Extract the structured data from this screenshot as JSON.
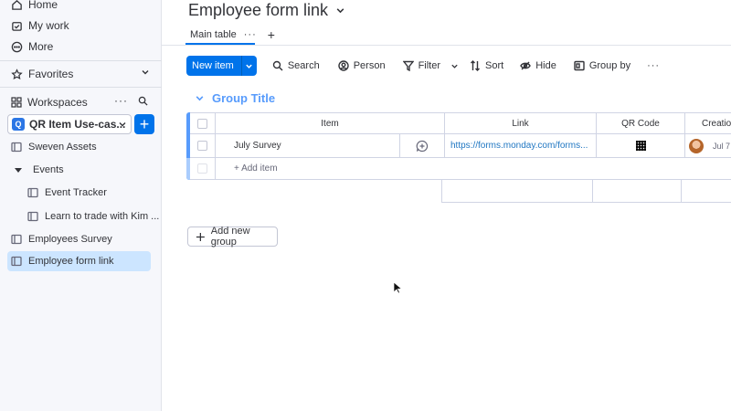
{
  "sidebar": {
    "nav": [
      {
        "label": "Home",
        "icon": "home-icon"
      },
      {
        "label": "My work",
        "icon": "calendar-check-icon"
      },
      {
        "label": "More",
        "icon": "more-circle-icon"
      }
    ],
    "favorites_label": "Favorites",
    "workspaces_label": "Workspaces",
    "workspace": {
      "badge": "Q",
      "name": "QR Item Use-cas..."
    },
    "tree": [
      {
        "label": "Sweven Assets",
        "type": "board"
      },
      {
        "label": "Events",
        "type": "folder"
      },
      {
        "label": "Event Tracker",
        "type": "board"
      },
      {
        "label": "Learn to trade with Kim ...",
        "type": "board"
      },
      {
        "label": "Employees Survey",
        "type": "board"
      },
      {
        "label": "Employee form link",
        "type": "board",
        "active": true
      }
    ]
  },
  "board": {
    "title": "Employee form link",
    "tabs": [
      {
        "label": "Main table"
      }
    ],
    "tab_add": "+"
  },
  "toolbar": {
    "new_item": "New item",
    "search": "Search",
    "person": "Person",
    "filter": "Filter",
    "sort": "Sort",
    "hide": "Hide",
    "group_by": "Group by",
    "more": "···"
  },
  "group": {
    "title": "Group Title",
    "columns": [
      "Item",
      "Link",
      "QR Code",
      "Creation"
    ],
    "rows": [
      {
        "item": "July Survey",
        "link": "https://forms.monday.com/forms...",
        "creation": "Jul 7"
      }
    ],
    "add_item": "+ Add item"
  },
  "add_new_group": "Add new group",
  "colors": {
    "primary": "#0073ea",
    "group_color": "#579bfc",
    "link": "#1f76c2",
    "active_nav_bg": "#cce5ff"
  }
}
